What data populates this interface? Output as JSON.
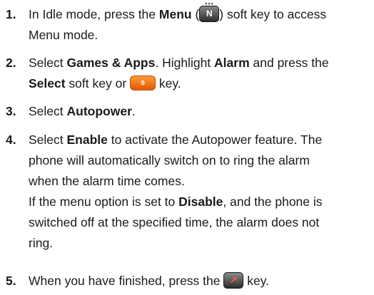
{
  "steps": [
    {
      "number": "1.",
      "lines": [
        {
          "pre": "In Idle mode, press the ",
          "bold": "Menu",
          "mid": " (",
          "post": ") soft key to access"
        },
        {
          "text": "Menu mode."
        }
      ],
      "icon": "menu-softkey-icon",
      "icon_glyph": "N"
    },
    {
      "number": "2.",
      "lines": [
        {
          "pre": "Select ",
          "bold1": "Games & Apps",
          "mid": ". Highlight ",
          "bold2": "Alarm",
          "post": " and press the"
        },
        {
          "bold": "Select",
          "mid": " soft key or ",
          "post": " key."
        }
      ],
      "icon": "select-key-icon",
      "icon_glyph": "s"
    },
    {
      "number": "3.",
      "lines": [
        {
          "pre": "Select ",
          "bold": "Autopower",
          "post": "."
        }
      ]
    },
    {
      "number": "4.",
      "lines": [
        {
          "pre": "Select ",
          "bold": "Enable",
          "post": " to activate the Autopower feature. The"
        },
        {
          "text": "phone will automatically switch on to ring the alarm"
        },
        {
          "text": "when the alarm time comes."
        },
        {
          "pre": "If the menu option is set to ",
          "bold": "Disable",
          "post": ", and the phone is"
        },
        {
          "text": "switched off at the specified time, the alarm does not"
        },
        {
          "text": "ring."
        }
      ]
    },
    {
      "number": "5.",
      "lines": [
        {
          "pre": "When you have finished, press the ",
          "post": " key."
        }
      ],
      "icon": "end-key-icon",
      "icon_glyph": "↗"
    }
  ]
}
